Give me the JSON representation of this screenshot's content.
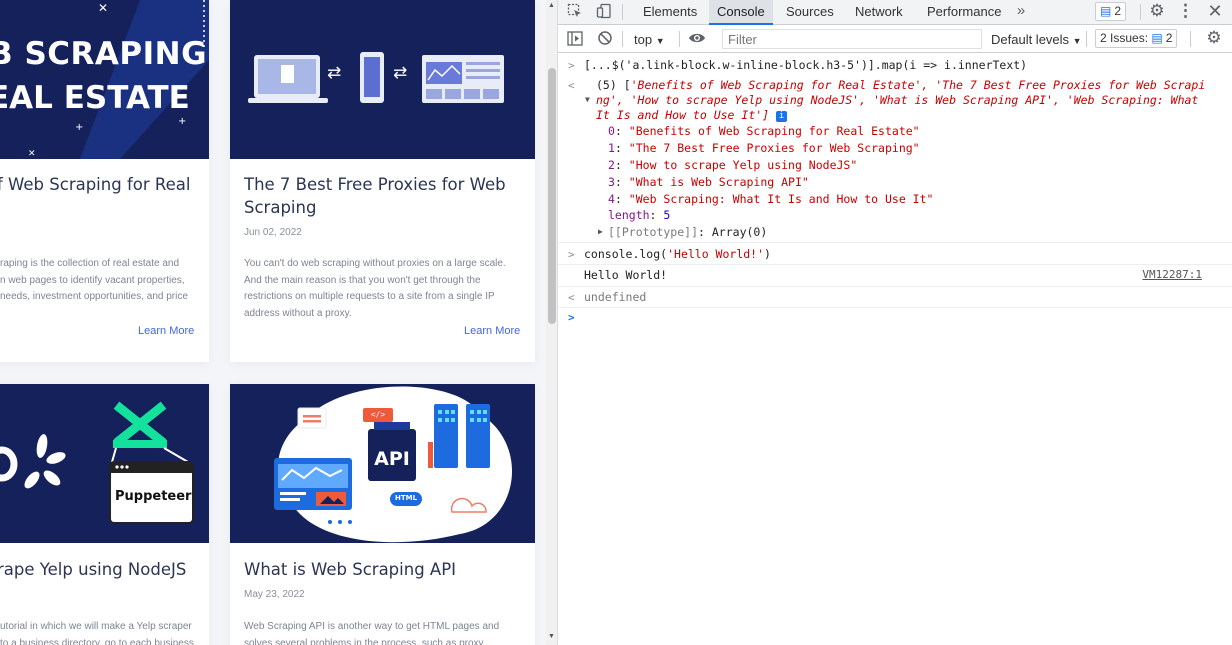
{
  "cards": [
    {
      "image_text_line1": "SCRAPING",
      "image_text_line1_prefix": "B",
      "image_text_line2": "EAL ESTATE",
      "title_line1": "f Web Scraping for Real",
      "desc_lines": [
        "raping is the collection of real estate and",
        "n web pages to identify vacant properties,",
        "needs, investment opportunities, and price"
      ],
      "link": "Learn More"
    },
    {
      "title_line1": "The 7 Best Free Proxies for Web",
      "title_line2": "Scraping",
      "date": "Jun 02, 2022",
      "desc_lines": [
        "You can't do web scraping without proxies on a large scale.",
        "And the main reason is that you won't get through the",
        "restrictions on multiple requests to a site from a single IP",
        "address without a proxy."
      ],
      "link": "Learn More"
    },
    {
      "image_label": "Puppeteer",
      "title_line1": "rape Yelp using NodeJS",
      "desc_lines": [
        "utorial in which we will make a Yelp scraper",
        "to a business directory, go to each business"
      ]
    },
    {
      "image_label": "API",
      "image_tag_code": "</>",
      "image_tag_html": "HTML",
      "title_line1": "What is Web Scraping API",
      "date": "May 23, 2022",
      "desc_lines": [
        "Web Scraping API is another way to get HTML pages and",
        "solves several problems in the process, such as proxy"
      ]
    }
  ],
  "devtools": {
    "tabs": [
      "Elements",
      "Console",
      "Sources",
      "Network",
      "Performance"
    ],
    "active_tab": "Console",
    "messages_badge": "2",
    "context": "top",
    "filter_placeholder": "Filter",
    "levels": "Default levels",
    "issues_label": "2 Issues:",
    "issues_count": "2",
    "console": {
      "cmd1": "[...$('a.link-block.w-inline-block.h3-5')].map(i => i.innerText)",
      "result_prefix": "(5) [",
      "result_line1": "'Benefits of Web Scraping for Real Estate', 'The 7 Best Free Proxies for Web Scrapi",
      "result_line2": "ng', 'How to scrape Yelp using NodeJS', 'What is Web Scraping API', 'Web Scraping: What",
      "result_line3": "It Is and How to Use It']",
      "items": [
        {
          "key": "0",
          "value": "\"Benefits of Web Scraping for Real Estate\""
        },
        {
          "key": "1",
          "value": "\"The 7 Best Free Proxies for Web Scraping\""
        },
        {
          "key": "2",
          "value": "\"How to scrape Yelp using NodeJS\""
        },
        {
          "key": "3",
          "value": "\"What is Web Scraping API\""
        },
        {
          "key": "4",
          "value": "\"Web Scraping: What It Is and How to Use It\""
        }
      ],
      "length_key": "length",
      "length_value": "5",
      "prototype_key": "[[Prototype]]",
      "prototype_value": "Array(0)",
      "cmd2_prefix": "console.log(",
      "cmd2_arg": "'Hello World!'",
      "cmd2_suffix": ")",
      "log_output": "Hello World!",
      "log_source": "VM12287:1",
      "return_value": "undefined"
    }
  }
}
